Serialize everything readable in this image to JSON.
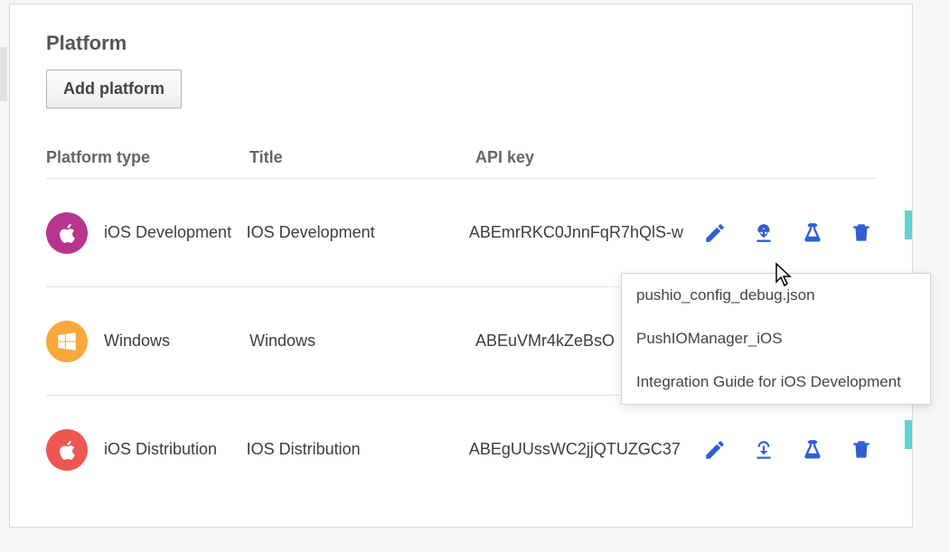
{
  "section": {
    "title": "Platform",
    "add_button": "Add platform"
  },
  "columns": {
    "platform": "Platform type",
    "title": "Title",
    "api": "API key"
  },
  "rows": [
    {
      "platform": "iOS Development",
      "title": "IOS Development",
      "api": "ABEmrRKC0JnnFqR7hQlS-w",
      "icon": "apple",
      "color": "magenta"
    },
    {
      "platform": "Windows",
      "title": "Windows",
      "api": "ABEuVMr4kZeBsO",
      "icon": "windows",
      "color": "orange"
    },
    {
      "platform": "iOS Distribution",
      "title": "IOS Distribution",
      "api": "ABEgUUssWC2jjQTUZGC37",
      "icon": "apple",
      "color": "red"
    }
  ],
  "dropdown": {
    "items": [
      "pushio_config_debug.json",
      "PushIOManager_iOS",
      "Integration Guide for iOS Development"
    ]
  },
  "icons": {
    "edit": "edit-icon",
    "download": "download-icon",
    "test": "flask-icon",
    "delete": "trash-icon"
  }
}
